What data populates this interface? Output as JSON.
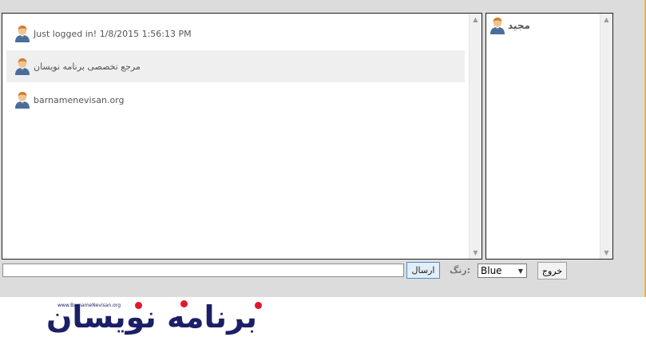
{
  "chat": {
    "messages": [
      {
        "text": "Just logged in! 1/8/2015 1:56:13 PM"
      },
      {
        "text": "مرجع تخصصی برنامه نویسان"
      },
      {
        "text": "barnamenevisan.org"
      }
    ]
  },
  "users": [
    {
      "name": "مجید"
    }
  ],
  "controls": {
    "message_value": "",
    "send_label": "ارسال",
    "color_label": "رنگ:",
    "color_selected": "Blue",
    "exit_label": "خروج"
  },
  "logo": {
    "url_text": "www.BarnameNevisan.org",
    "word": "برنامه نویسان"
  },
  "colors": {
    "accent_border": "#e2b84a",
    "send_border": "#4b8fd1",
    "logo_navy": "#1b1f66",
    "logo_red": "#e0182d"
  },
  "icons": {
    "avatar": "user-avatar-icon",
    "scroll_up": "chevron-up-icon",
    "scroll_down": "chevron-down-icon",
    "select_arrow": "chevron-down-icon"
  }
}
